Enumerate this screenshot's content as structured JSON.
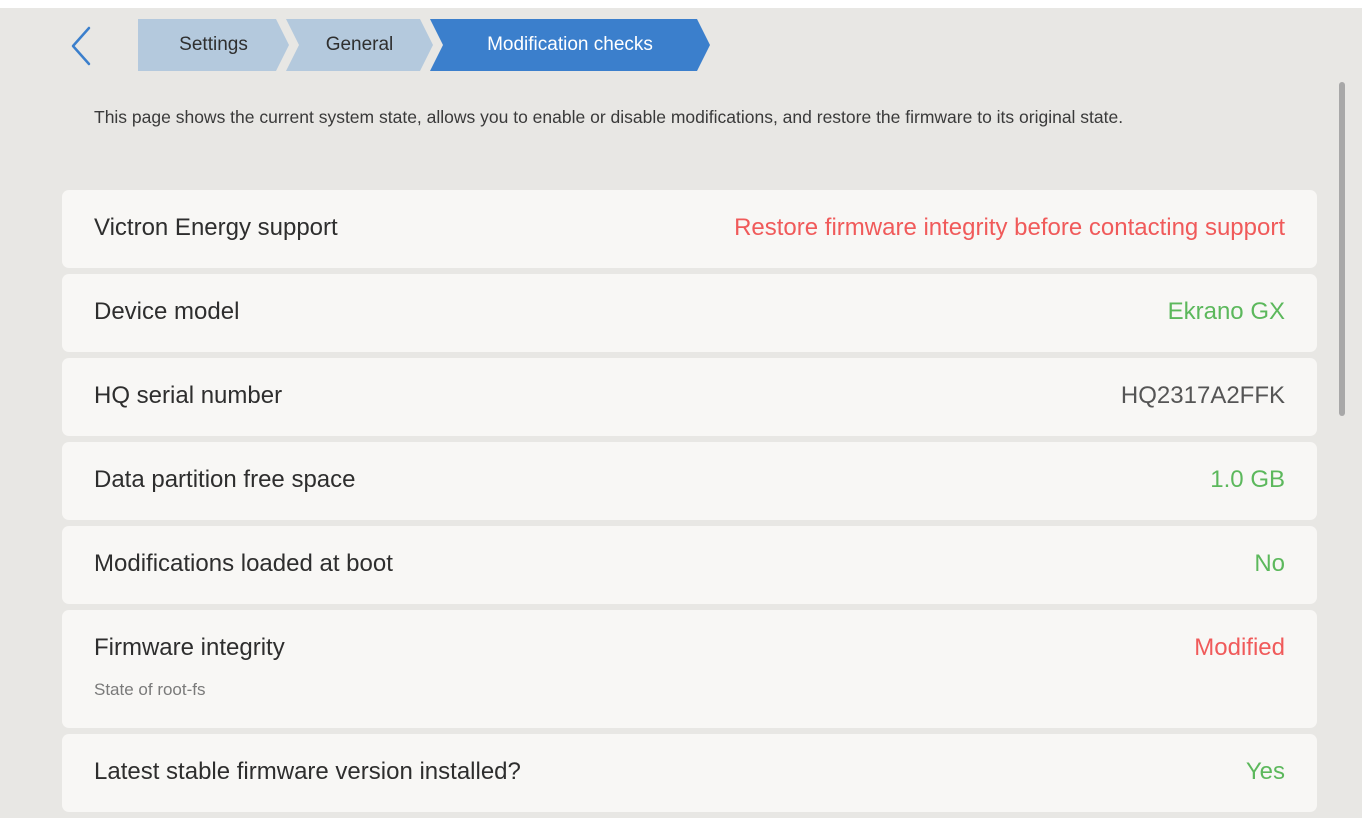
{
  "breadcrumb": {
    "items": [
      "Settings",
      "General",
      "Modification checks"
    ]
  },
  "intro_text": "This page shows the current system state, allows you to enable or disable modifications, and restore the firmware to its original state.",
  "rows": [
    {
      "label": "Victron Energy support",
      "value": "Restore firmware integrity before contacting support",
      "status": "red"
    },
    {
      "label": "Device model",
      "value": "Ekrano GX",
      "status": "green"
    },
    {
      "label": "HQ serial number",
      "value": "HQ2317A2FFK",
      "status": "gray"
    },
    {
      "label": "Data partition free space",
      "value": "1.0 GB",
      "status": "green"
    },
    {
      "label": "Modifications loaded at boot",
      "value": "No",
      "status": "green"
    },
    {
      "label": "Firmware integrity",
      "sublabel": "State of root-fs",
      "value": "Modified",
      "status": "red"
    },
    {
      "label": "Latest stable firmware version installed?",
      "value": "Yes",
      "status": "green"
    }
  ],
  "colors": {
    "background": "#e8e7e4",
    "row_background": "#f8f7f5",
    "crumb_inactive": "#b4c9dd",
    "crumb_active": "#3b7fcc",
    "accent_blue": "#3b7fcc",
    "status_red": "#f05a5a",
    "status_green": "#5cb85c"
  },
  "icons": {
    "back": "chevron-left-icon"
  }
}
